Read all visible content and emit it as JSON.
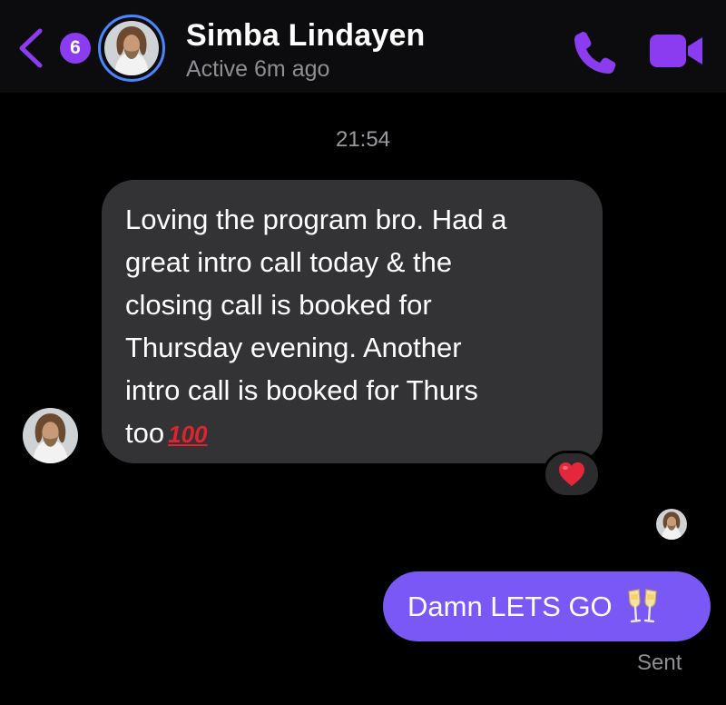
{
  "header": {
    "back_badge_count": "6",
    "contact_name": "Simba Lindayen",
    "contact_status": "Active 6m ago",
    "accent_color": "#8b3bf0"
  },
  "conversation": {
    "timestamp": "21:54",
    "incoming_message": {
      "lines": [
        "Loving the program bro. Had a",
        "great intro call today & the",
        "closing call is booked for",
        "Thursday evening. Another",
        "intro call is booked for Thurs",
        "too"
      ],
      "emoji": "100",
      "reaction": "red-heart",
      "bubble_color": "#333335"
    },
    "outgoing_message": {
      "text": "Damn LETS GO",
      "emoji": "clinking-glasses",
      "bubble_color": "#7a58f5",
      "status": "Sent"
    }
  }
}
